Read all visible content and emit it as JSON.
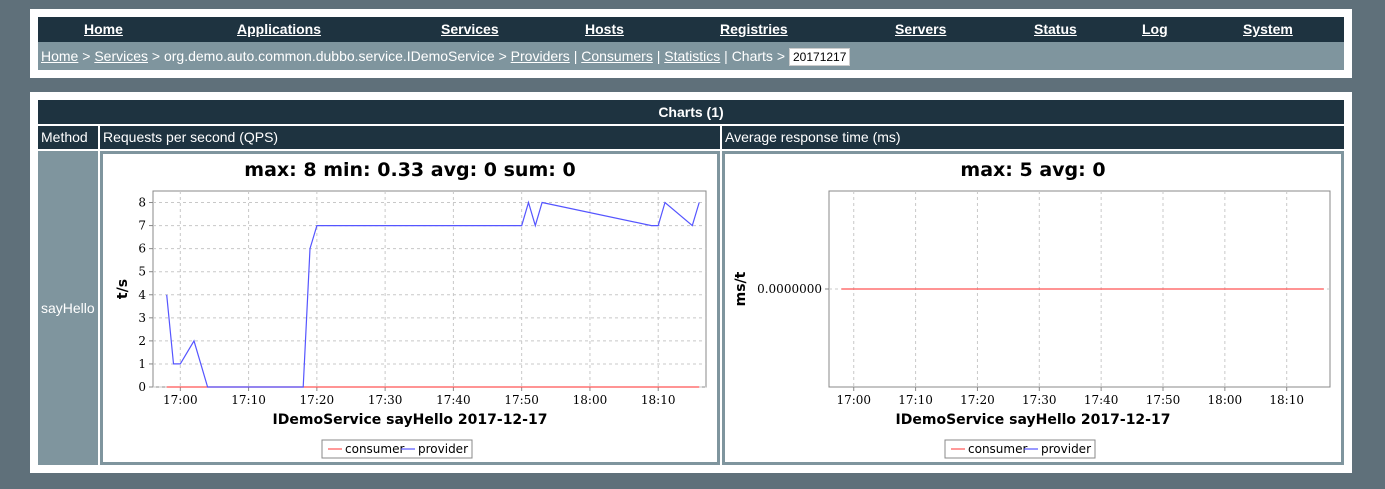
{
  "nav": [
    {
      "label": "Home"
    },
    {
      "label": "Applications"
    },
    {
      "label": "Services"
    },
    {
      "label": "Hosts"
    },
    {
      "label": "Registries"
    },
    {
      "label": "Servers"
    },
    {
      "label": "Status"
    },
    {
      "label": "Log"
    },
    {
      "label": "System"
    }
  ],
  "breadcrumb": {
    "home": "Home",
    "sep": ">",
    "services": "Services",
    "service_name": "org.demo.auto.common.dubbo.service.IDemoService",
    "providers": "Providers",
    "consumers": "Consumers",
    "statistics": "Statistics",
    "charts": "Charts",
    "pipe": "|",
    "date_value": "20171217"
  },
  "table": {
    "title": "Charts (1)",
    "col_method": "Method",
    "col_qps": "Requests per second (QPS)",
    "col_art": "Average response time (ms)",
    "method": "sayHello"
  },
  "colors": {
    "consumer": "#ff5555",
    "provider": "#5555ff"
  },
  "chart_data": [
    {
      "type": "line",
      "title": "max: 8 min: 0.33 avg: 0 sum: 0",
      "xlabel": "IDemoService  sayHello  2017-12-17",
      "ylabel": "t/s",
      "x_ticks": [
        "17:00",
        "17:10",
        "17:20",
        "17:30",
        "17:40",
        "17:50",
        "18:00",
        "18:10"
      ],
      "y_ticks": [
        "0",
        "1",
        "2",
        "3",
        "4",
        "5",
        "6",
        "7",
        "8"
      ],
      "ylim": [
        0,
        8.5
      ],
      "xlim": [
        "16:56",
        "18:17"
      ],
      "grid": true,
      "legend": "bottom",
      "series": [
        {
          "name": "consumer",
          "x": [
            "16:58",
            "18:16"
          ],
          "values": [
            0,
            0
          ]
        },
        {
          "name": "provider",
          "x": [
            "16:58",
            "16:59",
            "17:00",
            "17:02",
            "17:04",
            "17:18",
            "17:19",
            "17:20",
            "17:50",
            "17:51",
            "17:52",
            "17:53",
            "18:09",
            "18:10",
            "18:11",
            "18:15",
            "18:16"
          ],
          "values": [
            4,
            1,
            1,
            2,
            0,
            0,
            6,
            7,
            7,
            8,
            7,
            8,
            7,
            7,
            8,
            7,
            8
          ]
        }
      ]
    },
    {
      "type": "line",
      "title": "max: 5 avg: 0",
      "xlabel": "IDemoService  sayHello  2017-12-17",
      "ylabel": "ms/t",
      "x_ticks": [
        "17:00",
        "17:10",
        "17:20",
        "17:30",
        "17:40",
        "17:50",
        "18:00",
        "18:10"
      ],
      "y_ticks": [
        "0.0000000"
      ],
      "grid": true,
      "legend": "bottom",
      "series": [
        {
          "name": "consumer",
          "x": [
            "16:58",
            "18:16"
          ],
          "values": [
            0,
            0
          ]
        }
      ]
    }
  ]
}
